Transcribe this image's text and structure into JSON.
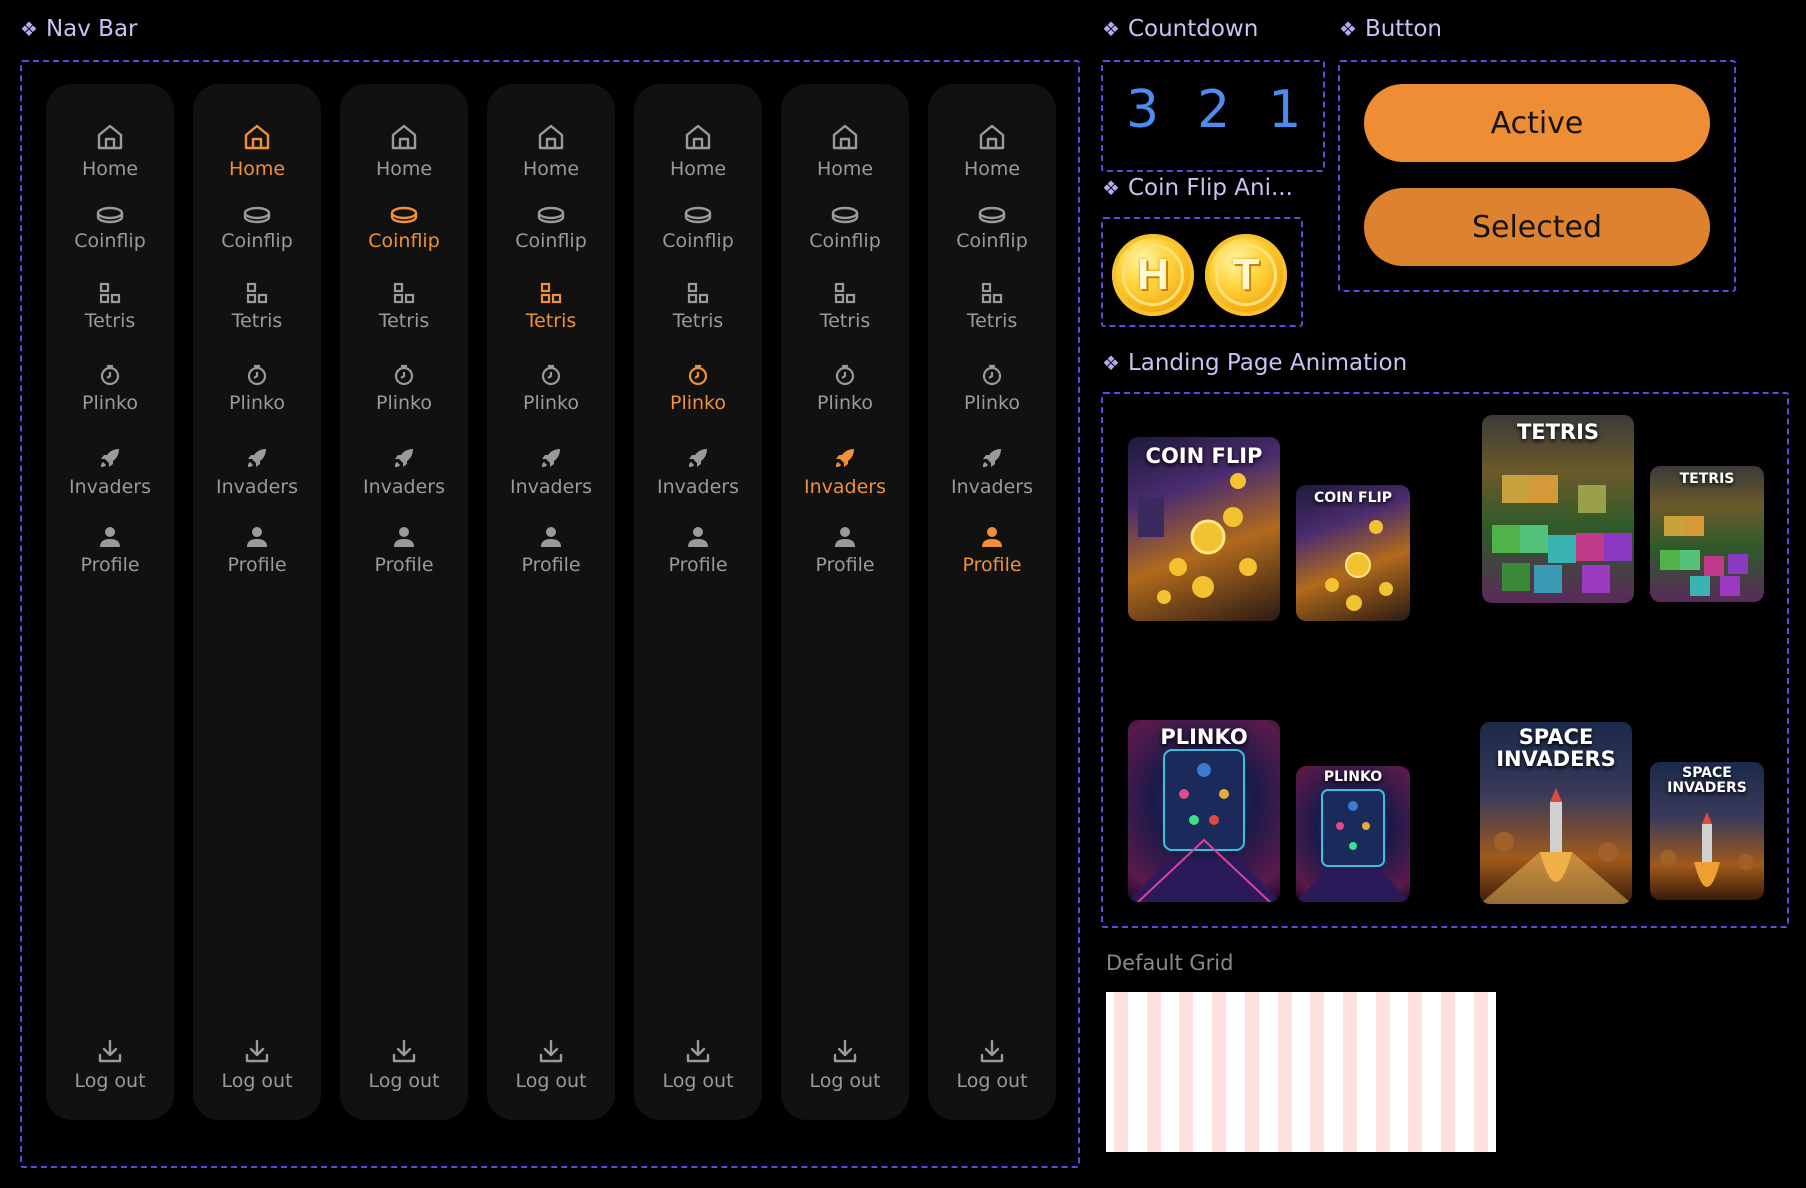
{
  "sections": {
    "nav_bar": "Nav Bar",
    "countdown": "Countdown",
    "button": "Button",
    "coin_flip": "Coin Flip Ani...",
    "landing": "Landing Page Animation",
    "default_grid": "Default Grid"
  },
  "section_icon": "❖",
  "nav": {
    "items": [
      "Home",
      "Coinflip",
      "Tetris",
      "Plinko",
      "Invaders",
      "Profile"
    ],
    "logout": "Log out",
    "icons": [
      "home-icon",
      "coin-icon",
      "blocks-icon",
      "plinko-icon",
      "rocket-icon",
      "user-icon",
      "download-icon"
    ],
    "active_index_per_column": [
      null,
      0,
      1,
      2,
      3,
      4,
      5
    ],
    "colors": {
      "active": "#f0903a",
      "inactive": "#9a9a9a",
      "panel": "#111111"
    }
  },
  "countdown": [
    "3",
    "2",
    "1"
  ],
  "buttons": {
    "active": "Active",
    "selected": "Selected",
    "active_color": "#ef8d35",
    "selected_color": "#df8230"
  },
  "coins": [
    "H",
    "T"
  ],
  "cards": {
    "coinflip": "COIN FLIP",
    "tetris": "TETRIS",
    "plinko": "PLINKO",
    "invaders": "SPACE INVADERS"
  },
  "accent_frame_color": "#6a44e0"
}
